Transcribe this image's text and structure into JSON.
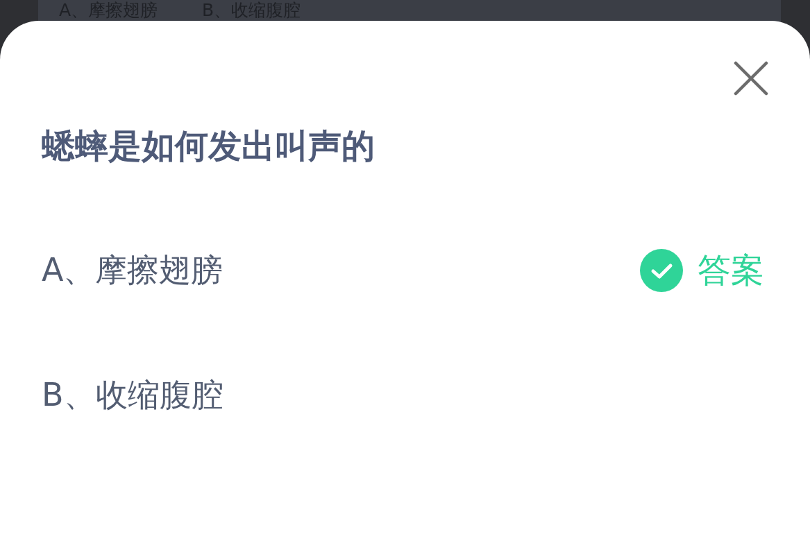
{
  "background_options": [
    "A、摩擦翅膀",
    "B、收缩腹腔"
  ],
  "question": {
    "title": "蟋蟀是如何发出叫声的",
    "answer_label": "答案",
    "options": [
      {
        "text": "A、摩擦翅膀",
        "is_answer": true
      },
      {
        "text": "B、收缩腹腔",
        "is_answer": false
      }
    ]
  }
}
